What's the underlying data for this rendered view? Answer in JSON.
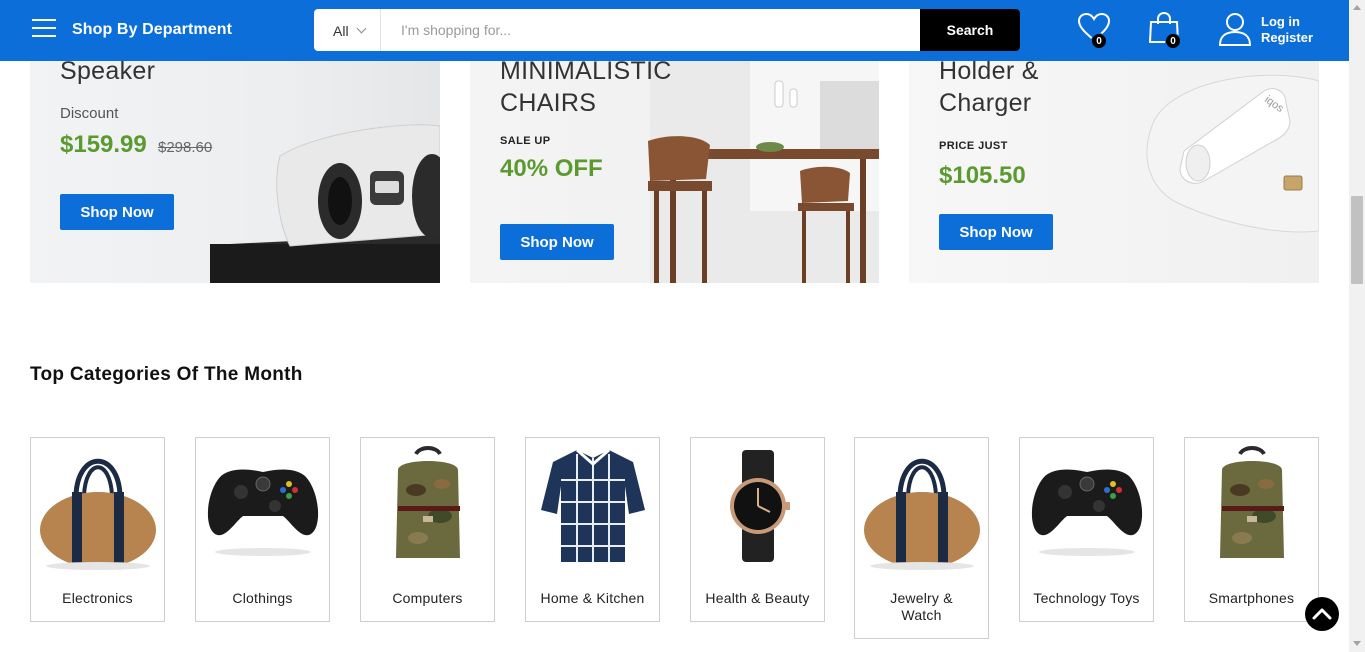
{
  "header": {
    "dept_label": "Shop By Department",
    "search": {
      "category": "All",
      "placeholder": "I'm shopping for...",
      "button": "Search"
    },
    "wishlist_count": "0",
    "cart_count": "0",
    "login_line1": "Log in",
    "login_line2": "Register"
  },
  "promos": [
    {
      "title": "Speaker",
      "sub": "Discount",
      "price": "$159.99",
      "old_price": "$298.60",
      "button": "Shop Now"
    },
    {
      "title_line1": "MINIMALISTIC",
      "title_line2": "CHAIRS",
      "small": "SALE UP",
      "price": "40% OFF",
      "button": "Shop Now"
    },
    {
      "title_line1": "Holder &",
      "title_line2": "Charger",
      "small": "PRICE JUST",
      "price": "$105.50",
      "button": "Shop Now",
      "brand_mark": "iqos"
    }
  ],
  "categories": {
    "heading": "Top Categories Of The Month",
    "items": [
      {
        "name": "Electronics",
        "icon": "duffel-bag-icon"
      },
      {
        "name": "Clothings",
        "icon": "game-controller-icon"
      },
      {
        "name": "Computers",
        "icon": "backpack-icon"
      },
      {
        "name": "Home & Kitchen",
        "icon": "shirt-icon"
      },
      {
        "name": "Health & Beauty",
        "icon": "watch-icon"
      },
      {
        "name": "Jewelry & Watch",
        "icon": "duffel-bag-icon"
      },
      {
        "name": "Technology Toys",
        "icon": "game-controller-icon"
      },
      {
        "name": "Smartphones",
        "icon": "backpack-icon"
      }
    ]
  },
  "colors": {
    "brand_blue": "#0c6ed8",
    "price_green": "#5a9a2e",
    "black": "#000000"
  }
}
